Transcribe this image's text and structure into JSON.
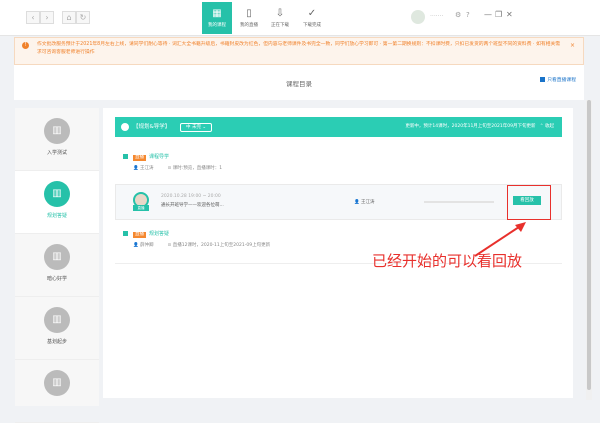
{
  "topbar": {
    "back": "‹",
    "forward": "›",
    "home": "⌂",
    "refresh": "↻",
    "tabs": [
      {
        "label": "我的课程",
        "icon": "grid-icon",
        "active": true
      },
      {
        "label": "我的直播",
        "icon": "book-icon"
      },
      {
        "label": "正在下载",
        "icon": "download-icon"
      },
      {
        "label": "下载完成",
        "icon": "check-circle-icon"
      }
    ],
    "username": "·······",
    "window": {
      "min": "—",
      "max": "❐",
      "close": "✕"
    }
  },
  "notice": {
    "text": "作文批改服务预计于2021年8月左右上线，请同学们耐心等待 · 词汇大全书籍升级后，书籍封皮改为红色，但内容与老师课件及书完全一致，同学们放心学习即可 · 第一第二期换规则：不扣课时费，只扣已发货的两个班型不同的资料费 · 如有相关需求可咨询客服老师进行操作",
    "close": "×"
  },
  "catalog": {
    "title": "课程目录",
    "checkbox": "只看直播课程"
  },
  "sidebar": {
    "items": [
      {
        "label": "入学测试"
      },
      {
        "label": "规划答疑",
        "active": true
      },
      {
        "label": "暗心好学"
      },
      {
        "label": "基划起步"
      },
      {
        "label": ""
      }
    ]
  },
  "course": {
    "title": "【规划&导学】",
    "status": "中 未完 ⌄",
    "info": "更新中，预计14课时，2020年11月上旬至2021年09月下旬更新",
    "collapse": "⌃ 收起",
    "sections": [
      {
        "tag": "直播",
        "title": "课程导学",
        "teacher": "王江涛",
        "meta": "课时:预览，直播课时：1",
        "lesson": {
          "badge": "直播",
          "time": "2020.10.28 19:00 ~ 20:00",
          "name": "通长开班导学——欢迎各位萌...",
          "teacher": "王江涛",
          "button": "看回放",
          "progress": 0
        }
      },
      {
        "tag": "直播",
        "title": "规划答疑",
        "teacher": "薛仲卿",
        "meta": "直播12课时，2020-11上旬至2021-09上旬更新"
      }
    ]
  },
  "annotation": "已经开始的可以看回放",
  "colors": {
    "accent": "#26c1a9",
    "warning": "#f0812b",
    "annotation": "#e8302c"
  }
}
